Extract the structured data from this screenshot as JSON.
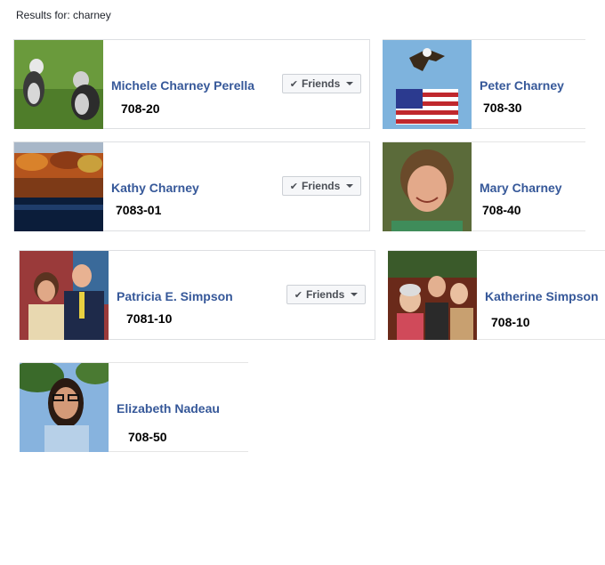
{
  "results_label": "Results for: charney",
  "friends_label": "Friends",
  "icons": {
    "check": "check-icon",
    "caret": "caret-down-icon"
  },
  "results": [
    {
      "name": "Michele Charney Perella",
      "code": "708-20",
      "is_friend": true,
      "photo": "two-schnauzer-dogs-on-grass"
    },
    {
      "name": "Peter Charney",
      "code": "708-30",
      "is_friend": false,
      "photo": "eagle-with-american-flag"
    },
    {
      "name": "Kathy Charney",
      "code": "7083-01",
      "is_friend": true,
      "photo": "autumn-trees-reflected-in-lake"
    },
    {
      "name": "Mary Charney",
      "code": "708-40",
      "is_friend": false,
      "photo": "smiling-woman-portrait"
    },
    {
      "name": "Patricia E. Simpson",
      "code": "7081-10",
      "is_friend": true,
      "photo": "couple-at-event"
    },
    {
      "name": "Katherine Simpson",
      "code": "708-10",
      "is_friend": false,
      "photo": "three-women-group"
    },
    {
      "name": "Elizabeth Nadeau",
      "code": "708-50",
      "is_friend": false,
      "photo": "woman-with-glasses-outdoors"
    }
  ]
}
